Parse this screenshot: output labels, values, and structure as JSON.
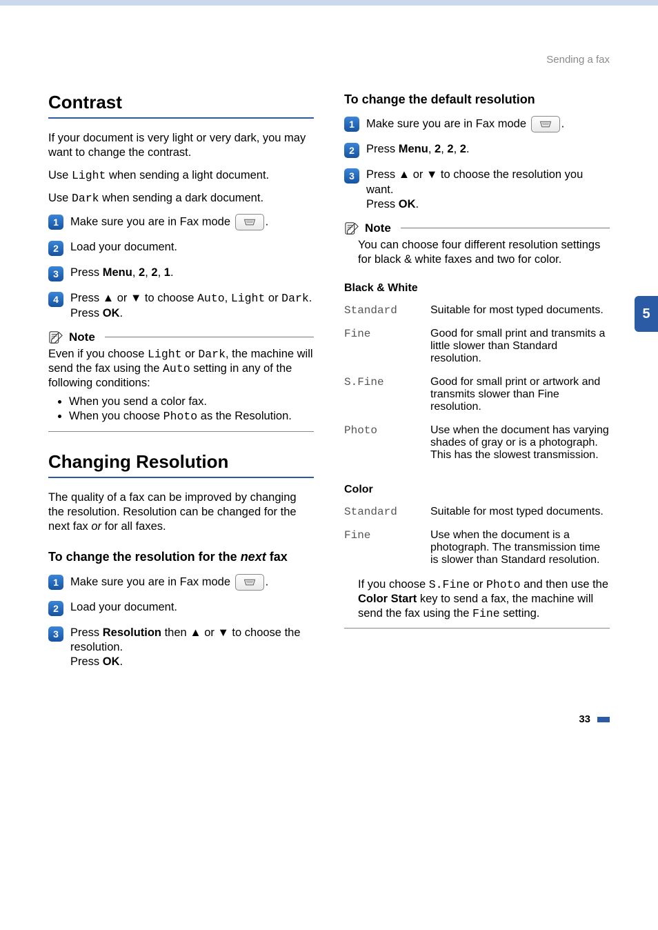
{
  "header": {
    "breadcrumb": "Sending a fax"
  },
  "sideTab": "5",
  "pageNumber": "33",
  "left": {
    "contrast": {
      "title": "Contrast",
      "intro": "If your document is very light or very dark, you may want to change the contrast.",
      "useLight_pre": "Use ",
      "useLight_mono": "Light",
      "useLight_post": " when sending a light document.",
      "useDark_pre": "Use ",
      "useDark_mono": "Dark",
      "useDark_post": " when sending a dark document.",
      "steps": {
        "s1_pre": "Make sure you are in Fax mode ",
        "s1_post": ".",
        "s2": "Load your document.",
        "s3_pre": "Press ",
        "s3_menu": "Menu",
        "s3_mid": ", ",
        "s3_k1": "2",
        "s3_k2": "2",
        "s3_k3": "1",
        "s3_post": ".",
        "s4_pre": "Press ",
        "s4_up": "▲",
        "s4_or1": " or ",
        "s4_down": "▼",
        "s4_mid": " to choose ",
        "s4_auto": "Auto",
        "s4_comma": ", ",
        "s4_light": "Light",
        "s4_or2": " or ",
        "s4_dark": "Dark",
        "s4_dot": ".",
        "s4_press": "Press ",
        "s4_ok": "OK",
        "s4_post": "."
      },
      "note": {
        "label": "Note",
        "body_pre": "Even if you choose ",
        "body_light": "Light",
        "body_or": " or ",
        "body_dark": "Dark",
        "body_mid": ", the machine will send the fax using the ",
        "body_auto": "Auto",
        "body_post": " setting in any of the following conditions:",
        "bullet1": "When you send a color fax.",
        "bullet2_pre": "When you choose ",
        "bullet2_mono": "Photo",
        "bullet2_post": " as the Resolution."
      }
    },
    "resolution": {
      "title": "Changing Resolution",
      "intro_pre": "The quality of a fax can be improved by changing the resolution. Resolution can be changed for the next fax ",
      "intro_em": "or",
      "intro_post": " for all faxes.",
      "subheading_pre": "To change the resolution for the ",
      "subheading_em": "next",
      "subheading_post": " fax",
      "steps": {
        "s1_pre": "Make sure you are in Fax mode ",
        "s1_post": ".",
        "s2": "Load your document.",
        "s3_pre": "Press ",
        "s3_res": "Resolution",
        "s3_then": " then ",
        "s3_up": "▲",
        "s3_or": " or ",
        "s3_down": "▼",
        "s3_mid": " to choose the resolution.",
        "s3_press": "Press ",
        "s3_ok": "OK",
        "s3_post": "."
      }
    }
  },
  "right": {
    "defaultRes": {
      "title": "To change the default resolution",
      "steps": {
        "s1_pre": "Make sure you are in Fax mode ",
        "s1_post": ".",
        "s2_pre": "Press ",
        "s2_menu": "Menu",
        "s2_mid": ", ",
        "s2_k1": "2",
        "s2_k2": "2",
        "s2_k3": "2",
        "s2_post": ".",
        "s3_pre": "Press ",
        "s3_up": "▲",
        "s3_or": " or ",
        "s3_down": "▼",
        "s3_mid": " to choose the resolution you want.",
        "s3_press": "Press ",
        "s3_ok": "OK",
        "s3_post": "."
      },
      "note": {
        "label": "Note",
        "body": "You can choose four different resolution settings for black & white faxes and two for color."
      },
      "bwLabel": "Black & White",
      "bw": {
        "standard_k": "Standard",
        "standard_v": "Suitable for most typed documents.",
        "fine_k": "Fine",
        "fine_v": "Good for small print and transmits a little slower than Standard resolution.",
        "sfine_k": "S.Fine",
        "sfine_v": "Good for small print or artwork and transmits slower than Fine resolution.",
        "photo_k": "Photo",
        "photo_v": "Use when the document has varying shades of gray or is a photograph. This has the slowest transmission."
      },
      "colorLabel": "Color",
      "color": {
        "standard_k": "Standard",
        "standard_v": "Suitable for most typed documents.",
        "fine_k": "Fine",
        "fine_v": "Use when the document is a photograph. The transmission time is slower than Standard resolution."
      },
      "footnote_pre": "If you choose ",
      "footnote_sfine": "S.Fine",
      "footnote_or": " or ",
      "footnote_photo": "Photo",
      "footnote_mid1": " and then use the ",
      "footnote_cs": "Color Start",
      "footnote_mid2": " key to send a fax, the machine will send the fax using the ",
      "footnote_fine": "Fine",
      "footnote_post": " setting."
    }
  }
}
